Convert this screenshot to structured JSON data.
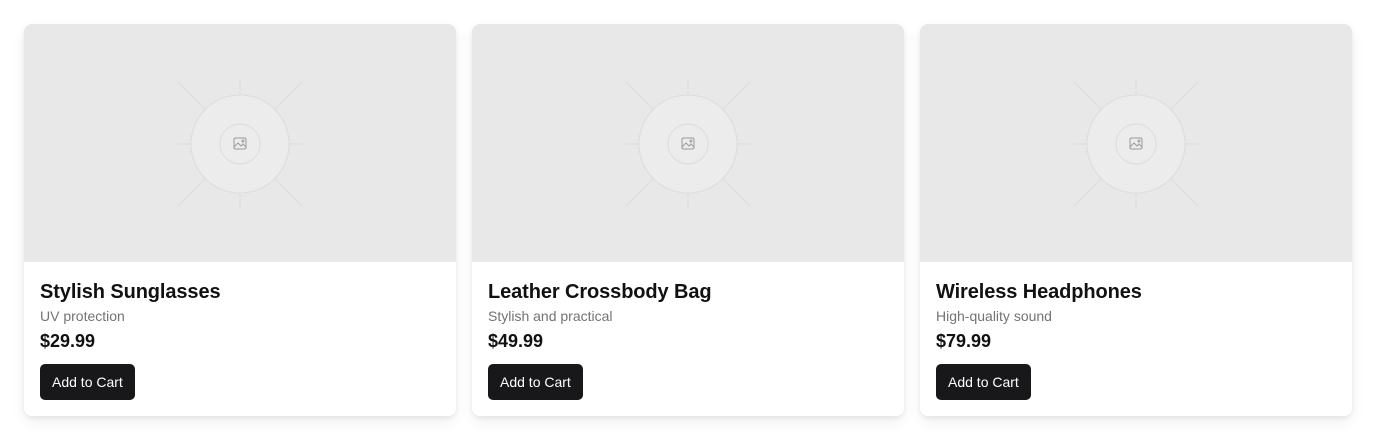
{
  "products": [
    {
      "title": "Stylish Sunglasses",
      "description": "UV protection",
      "price": "$29.99",
      "button_label": "Add to Cart",
      "image_icon": "image-placeholder-icon"
    },
    {
      "title": "Leather Crossbody Bag",
      "description": "Stylish and practical",
      "price": "$49.99",
      "button_label": "Add to Cart",
      "image_icon": "image-placeholder-icon"
    },
    {
      "title": "Wireless Headphones",
      "description": "High-quality sound",
      "price": "$79.99",
      "button_label": "Add to Cart",
      "image_icon": "image-placeholder-icon"
    }
  ],
  "colors": {
    "button_bg": "#18181b",
    "placeholder_bg": "#e8e8e8",
    "muted_text": "#737373"
  }
}
